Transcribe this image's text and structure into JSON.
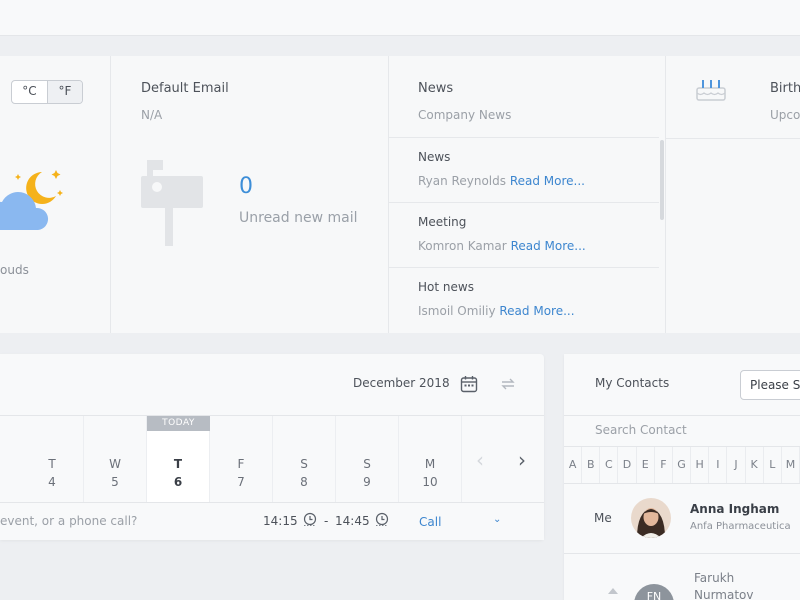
{
  "weather": {
    "units": [
      "°C",
      "°F"
    ],
    "condition_partial": "ouds",
    "icon": "moon-cloud-icon"
  },
  "email": {
    "title": "Default Email",
    "address": "N/A",
    "unread_count": "0",
    "unread_label": "Unread new mail",
    "icon": "mailbox-icon"
  },
  "news": {
    "title": "News",
    "subtitle": "Company News",
    "read_more": "Read More...",
    "items": [
      {
        "title": "News",
        "author": "Ryan Reynolds"
      },
      {
        "title": "Meeting",
        "author": "Komron Kamar"
      },
      {
        "title": "Hot news",
        "author": "Ismoil Omiliy"
      }
    ]
  },
  "birthdays": {
    "title_partial": "Birth",
    "subtitle_partial": "Upco",
    "icon": "cake-icon"
  },
  "calendar": {
    "month": "December 2018",
    "today_badge": "TODAY",
    "days": [
      {
        "letter": "T",
        "num": "4"
      },
      {
        "letter": "W",
        "num": "5"
      },
      {
        "letter": "T",
        "num": "6",
        "today": true
      },
      {
        "letter": "F",
        "num": "7"
      },
      {
        "letter": "S",
        "num": "8"
      },
      {
        "letter": "S",
        "num": "9"
      },
      {
        "letter": "M",
        "num": "10"
      }
    ],
    "event_placeholder": "event, or a phone call?",
    "start_time": "14:15",
    "time_separator": "-",
    "end_time": "14:45",
    "event_type": "Call"
  },
  "contacts": {
    "title": "My Contacts",
    "select_value": "Please S",
    "search_placeholder": "Search Contact",
    "alphabet": [
      "A",
      "B",
      "C",
      "D",
      "E",
      "F",
      "G",
      "H",
      "I",
      "J",
      "K",
      "L",
      "M"
    ],
    "me_label": "Me",
    "me_name": "Anna Ingham",
    "me_company": "Anfa Pharmaceutica",
    "second_name": "Farukh Nurmatov",
    "second_initials": "FN"
  },
  "colors": {
    "accent": "#3d86cf",
    "background": "#edeff2",
    "card": "#f8f9fa"
  }
}
